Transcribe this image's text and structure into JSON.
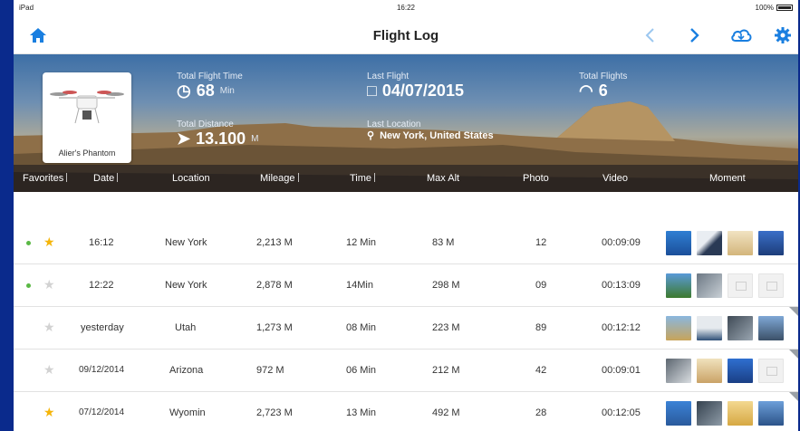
{
  "status": {
    "device": "iPad",
    "time": "16:22",
    "battery": "100%"
  },
  "nav": {
    "title": "Flight Log"
  },
  "aircraft": {
    "name": "Alier's Phantom"
  },
  "stats": {
    "total_flight_time_label": "Total Flight Time",
    "total_flight_time_value": "68",
    "total_flight_time_unit": "Min",
    "last_flight_label": "Last Flight",
    "last_flight_value": "04/07/2015",
    "total_flights_label": "Total Flights",
    "total_flights_value": "6",
    "total_distance_label": "Total Distance",
    "total_distance_value": "13.100",
    "total_distance_unit": "M",
    "last_location_label": "Last Location",
    "last_location_value": "New York, United States"
  },
  "columns": {
    "favorites": "Favorites",
    "date": "Date",
    "location": "Location",
    "mileage": "Mileage",
    "time": "Time",
    "max_alt": "Max Alt",
    "photo": "Photo",
    "video": "Video",
    "moment": "Moment"
  },
  "rows": [
    {
      "date": "16:12",
      "location": "New York",
      "mileage": "2,213 M",
      "time": "12 Min",
      "max_alt": "83 M",
      "photo": "12",
      "video": "00:09:09"
    },
    {
      "date": "12:22",
      "location": "New York",
      "mileage": "2,878 M",
      "time": "14Min",
      "max_alt": "298 M",
      "photo": "09",
      "video": "00:13:09"
    },
    {
      "date": "yesterday",
      "location": "Utah",
      "mileage": "1,273 M",
      "time": "08 Min",
      "max_alt": "223 M",
      "photo": "89",
      "video": "00:12:12"
    },
    {
      "date": "09/12/2014",
      "location": "Arizona",
      "mileage": "972 M",
      "time": "06 Min",
      "max_alt": "212 M",
      "photo": "42",
      "video": "00:09:01"
    },
    {
      "date": "07/12/2014",
      "location": "Wyomin",
      "mileage": "2,723 M",
      "time": "13 Min",
      "max_alt": "492 M",
      "photo": "28",
      "video": "00:12:05"
    }
  ],
  "colors": {
    "accent": "#1a7fe0",
    "star_on": "#f5b50a",
    "online_dot": "#5ab845"
  }
}
